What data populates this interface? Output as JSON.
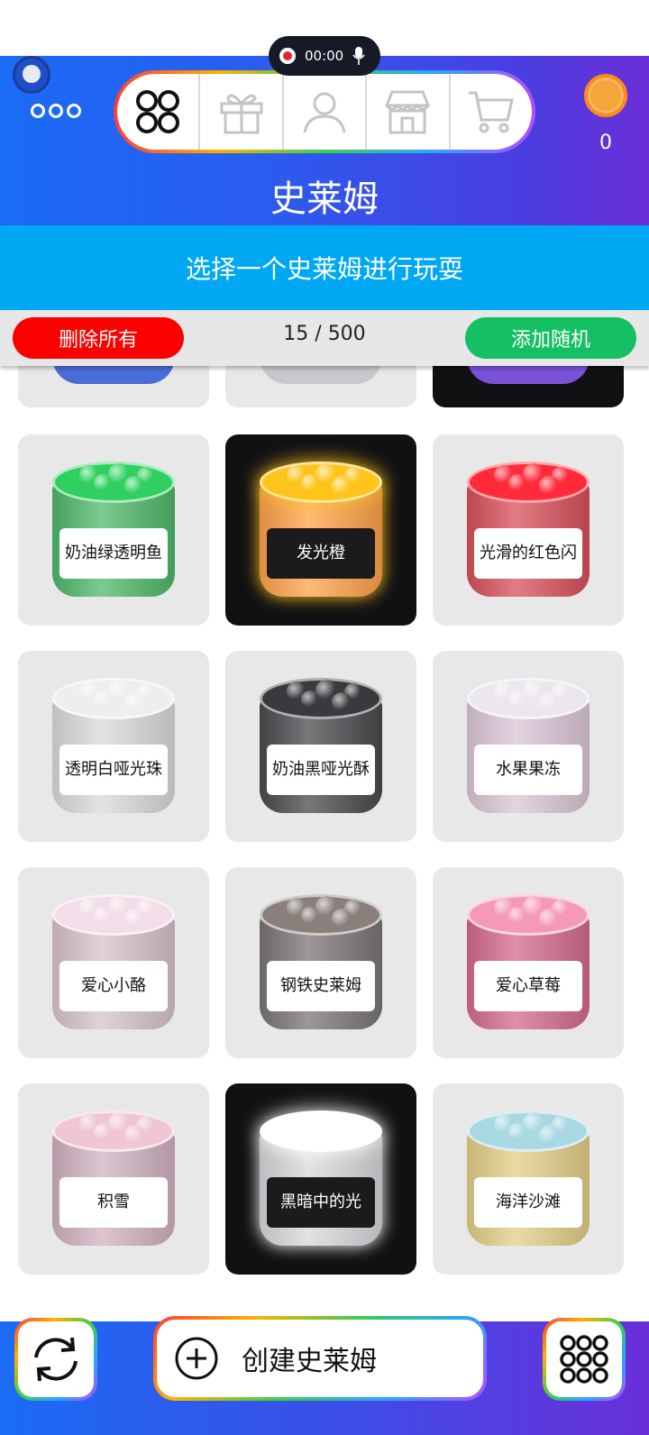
{
  "recorder": {
    "time": "00:00"
  },
  "header": {
    "title": "史莱姆",
    "coin_count": "0",
    "nav_icons": [
      "grid-icon",
      "gift-icon",
      "profile-icon",
      "shop-icon",
      "cart-icon"
    ]
  },
  "subtitle": "选择一个史莱姆进行玩耍",
  "toolbar": {
    "delete_all": "删除所有",
    "counter": "15 / 500",
    "add_random": "添加随机"
  },
  "slimes": [
    {
      "name": "奶油绿透明鱼",
      "body": "#4fb86a",
      "top": "#2fd060",
      "dark": false
    },
    {
      "name": "发光橙",
      "body": "#ffa24a",
      "top": "#ffc41a",
      "dark": true
    },
    {
      "name": "光滑的红色闪",
      "body": "#d8505a",
      "top": "#ff2b3b",
      "dark": false
    },
    {
      "name": "透明白哑光珠",
      "body": "#d9dadc",
      "top": "#eceef0",
      "dark": false
    },
    {
      "name": "奶油黑哑光酥",
      "body": "#4a4a4e",
      "top": "#3a3a3e",
      "dark": false
    },
    {
      "name": "水果果冻",
      "body": "#dcc6d6",
      "top": "#ece6ee",
      "dark": false
    },
    {
      "name": "爱心小酪",
      "body": "#d8c2cc",
      "top": "#f2dde8",
      "dark": false
    },
    {
      "name": "钢铁史莱姆",
      "body": "#7a7476",
      "top": "#8a7f7a",
      "dark": false
    },
    {
      "name": "爱心草莓",
      "body": "#d46a8e",
      "top": "#f49ab8",
      "dark": false
    },
    {
      "name": "积雪",
      "body": "#d0b2c0",
      "top": "#f0c6d6",
      "dark": false
    },
    {
      "name": "黑暗中的光",
      "body": "#d8d8dc",
      "top": "#ffffff",
      "dark": true
    },
    {
      "name": "海洋沙滩",
      "body": "#e2cf86",
      "top": "#a8d8e0",
      "dark": false
    }
  ],
  "partial_row": [
    {
      "body": "#4a6cd8",
      "dark": false
    },
    {
      "body": "#c8c8cc",
      "dark": false
    },
    {
      "body": "#7a52d8",
      "dark": true
    }
  ],
  "bottom": {
    "create_label": "创建史莱姆"
  }
}
